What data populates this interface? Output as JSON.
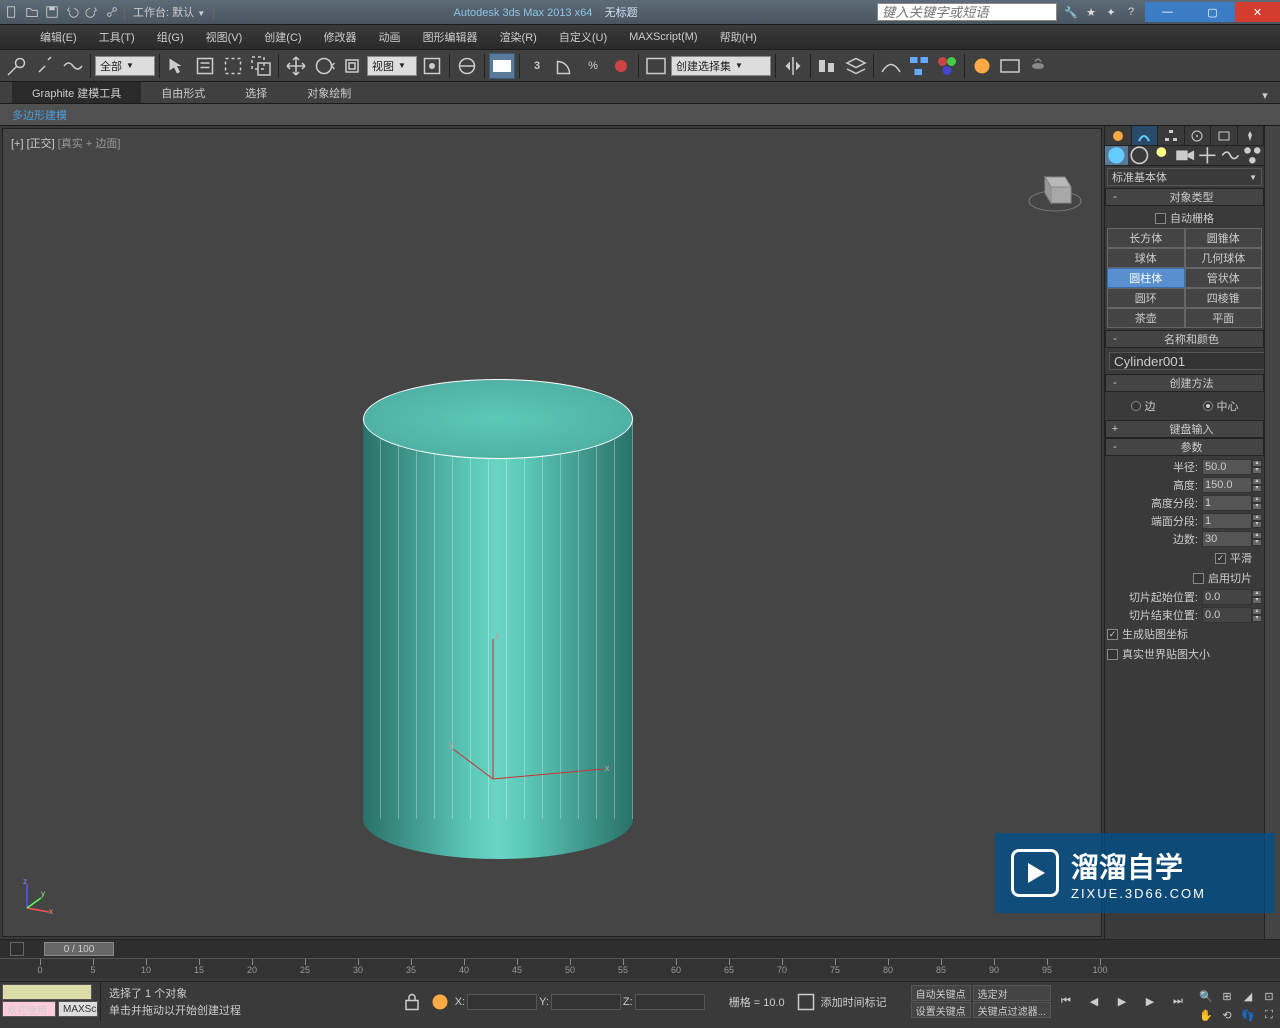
{
  "titlebar": {
    "workspace_label": "工作台: 默认",
    "app_title": "Autodesk 3ds Max  2013 x64",
    "doc_title": "无标题",
    "search_placeholder": "键入关键字或短语"
  },
  "menubar": {
    "items": [
      "编辑(E)",
      "工具(T)",
      "组(G)",
      "视图(V)",
      "创建(C)",
      "修改器",
      "动画",
      "图形编辑器",
      "渲染(R)",
      "自定义(U)",
      "MAXScript(M)",
      "帮助(H)"
    ]
  },
  "toolbar": {
    "filter_combo": "全部",
    "view_combo": "视图",
    "named_sets": "创建选择集"
  },
  "ribbon": {
    "tabs": [
      "Graphite 建模工具",
      "自由形式",
      "选择",
      "对象绘制"
    ],
    "subtab": "多边形建模"
  },
  "viewport": {
    "label_prefix": "[+]",
    "label_view": "[正交]",
    "label_shading": "[真实 + 边面]"
  },
  "command_panel": {
    "category_dropdown": "标准基本体",
    "rollouts": {
      "object_type": {
        "title": "对象类型",
        "autogrid": "自动栅格",
        "buttons": [
          [
            "长方体",
            "圆锥体"
          ],
          [
            "球体",
            "几何球体"
          ],
          [
            "圆柱体",
            "管状体"
          ],
          [
            "圆环",
            "四棱锥"
          ],
          [
            "茶壶",
            "平面"
          ]
        ],
        "active": "圆柱体"
      },
      "name_color": {
        "title": "名称和颜色",
        "name": "Cylinder001"
      },
      "creation_method": {
        "title": "创建方法",
        "radio_edge": "边",
        "radio_center": "中心",
        "selected": "中心"
      },
      "keyboard_entry": {
        "title": "键盘输入"
      },
      "parameters": {
        "title": "参数",
        "radius_label": "半径:",
        "radius": "50.0",
        "height_label": "高度:",
        "height": "150.0",
        "height_segs_label": "高度分段:",
        "height_segs": "1",
        "cap_segs_label": "端面分段:",
        "cap_segs": "1",
        "sides_label": "边数:",
        "sides": "30",
        "smooth": "平滑",
        "slice_on": "启用切片",
        "slice_from_label": "切片起始位置:",
        "slice_from": "0.0",
        "slice_to_label": "切片结束位置:",
        "slice_to": "0.0",
        "gen_mapping": "生成贴图坐标",
        "real_world": "真实世界贴图大小"
      }
    }
  },
  "timeline": {
    "handle": "0 / 100",
    "ticks": [
      0,
      5,
      10,
      15,
      20,
      25,
      30,
      35,
      40,
      45,
      50,
      55,
      60,
      65,
      70,
      75,
      80,
      85,
      90,
      95,
      100
    ]
  },
  "statusbar": {
    "welcome": "欢迎使用",
    "maxscript_btn": "MAXScr",
    "line1": "选择了 1 个对象",
    "line2": "单击并拖动以开始创建过程",
    "x_label": "X:",
    "y_label": "Y:",
    "z_label": "Z:",
    "grid_label": "栅格 = 10.0",
    "add_time_tag": "添加时间标记",
    "auto_key": "自动关键点",
    "set_key": "设置关键点",
    "selected_label": "选定对",
    "key_filters": "关键点过滤器..."
  },
  "watermark": {
    "main": "溜溜自学",
    "sub": "ZIXUE.3D66.COM"
  }
}
